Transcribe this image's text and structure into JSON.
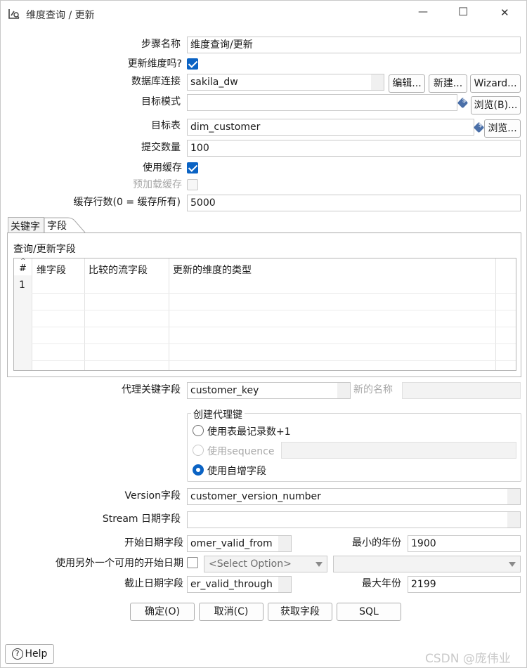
{
  "window": {
    "title": "维度查询 / 更新",
    "controls": {
      "minimize": "—",
      "maximize": "☐",
      "close": "✕"
    }
  },
  "form": {
    "step_name_label": "步骤名称",
    "step_name_value": "维度查询/更新",
    "update_dim_label": "更新维度吗?",
    "update_dim_checked": true,
    "db_conn_label": "数据库连接",
    "db_conn_value": "sakila_dw",
    "edit_btn": "编辑...",
    "new_btn": "新建...",
    "wizard_btn": "Wizard...",
    "target_schema_label": "目标模式",
    "target_schema_value": "",
    "browse_schema_btn": "浏览(B)...",
    "target_table_label": "目标表",
    "target_table_value": "dim_customer",
    "browse_table_btn": "浏览...",
    "commit_size_label": "提交数量",
    "commit_size_value": "100",
    "use_cache_label": "使用缓存",
    "use_cache_checked": true,
    "preload_cache_label": "预加载缓存",
    "preload_cache_checked": false,
    "cache_rows_label": "缓存行数(0 = 缓存所有)",
    "cache_rows_value": "5000"
  },
  "tabs": [
    {
      "label": "关键字",
      "active": false
    },
    {
      "label": "字段",
      "active": true
    }
  ],
  "fields_panel": {
    "title": "查询/更新字段",
    "columns": [
      "#",
      "维字段",
      "比较的流字段",
      "更新的维度的类型"
    ],
    "rows": [
      {
        "num": "1",
        "dim_field": "",
        "stream_field": "",
        "type": ""
      }
    ]
  },
  "surrogate": {
    "label": "代理关键字段",
    "value": "customer_key",
    "new_name_label": "新的名称",
    "new_name_value": "",
    "group_title": "创建代理键",
    "options": [
      {
        "label": "使用表最记录数+1",
        "selected": false,
        "disabled": false
      },
      {
        "label": "使用sequence",
        "selected": false,
        "disabled": true
      },
      {
        "label": "使用自增字段",
        "selected": true,
        "disabled": false
      }
    ]
  },
  "version": {
    "version_label": "Version字段",
    "version_value": "customer_version_number",
    "stream_date_label": "Stream 日期字段",
    "stream_date_value": "",
    "start_date_label": "开始日期字段",
    "start_date_value": "omer_valid_from",
    "min_year_label": "最小的年份",
    "min_year_value": "1900",
    "alt_start_label": "使用另外一个可用的开始日期",
    "alt_start_checked": false,
    "alt_start_select": "<Select Option>",
    "alt_start_select2": "",
    "end_date_label": "截止日期字段",
    "end_date_value": "er_valid_through",
    "max_year_label": "最大年份",
    "max_year_value": "2199"
  },
  "buttons": {
    "ok": "确定(O)",
    "cancel": "取消(C)",
    "get_fields": "获取字段",
    "sql": "SQL",
    "help": "Help"
  },
  "watermark": "CSDN @庞伟业"
}
